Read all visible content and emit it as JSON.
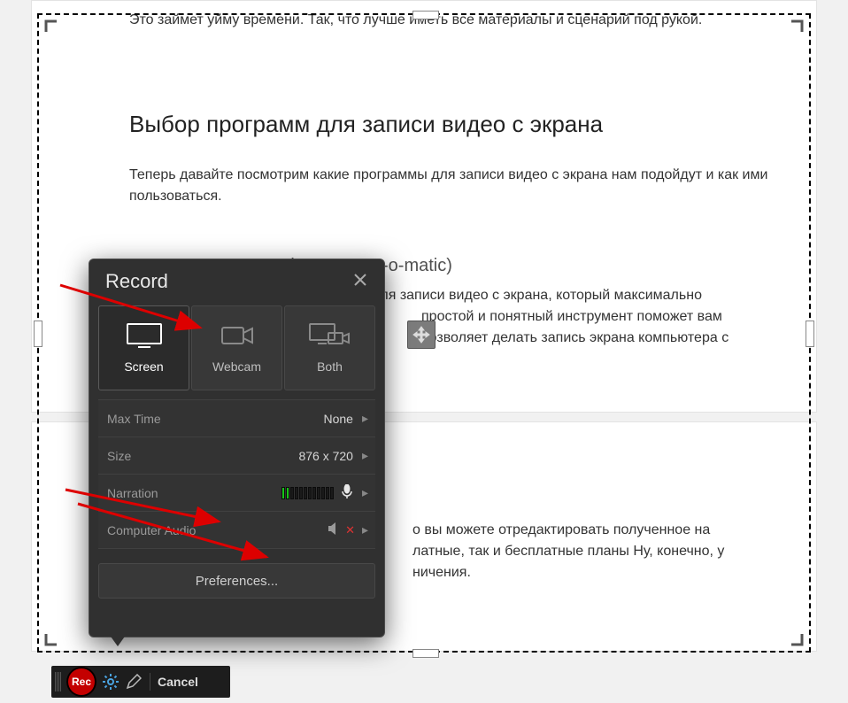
{
  "article": {
    "intro_cut": "Это займет уйму времени. Так, что лучше иметь все материалы и сценарий под рукой.",
    "h2": "Выбор программ для записи видео с экрана",
    "p1": "Теперь давайте посмотрим какие программы для записи видео с экрана нам подойдут и как ими пользоваться.",
    "h3": "Скринкаст-о-метик (Screencast-o-matic)",
    "p2": "Screencast-O-Matic - это инструмент для записи видео с экрана, который максимально",
    "p2b": "простой и понятный инструмент поможет вам",
    "p2c": "позволяет делать запись экрана компьютера с",
    "p3a": "о вы можете отредактировать полученное на",
    "p3b": "латные, так и бесплатные планы Ну, конечно, у",
    "p3c": "ничения."
  },
  "popup": {
    "title": "Record",
    "sources": {
      "screen": "Screen",
      "webcam": "Webcam",
      "both": "Both"
    },
    "max_time_label": "Max Time",
    "max_time_value": "None",
    "size_label": "Size",
    "size_value": "876 x 720",
    "narration_label": "Narration",
    "computer_audio_label": "Computer Audio",
    "preferences": "Preferences..."
  },
  "toolbar": {
    "rec": "Rec",
    "cancel": "Cancel"
  }
}
